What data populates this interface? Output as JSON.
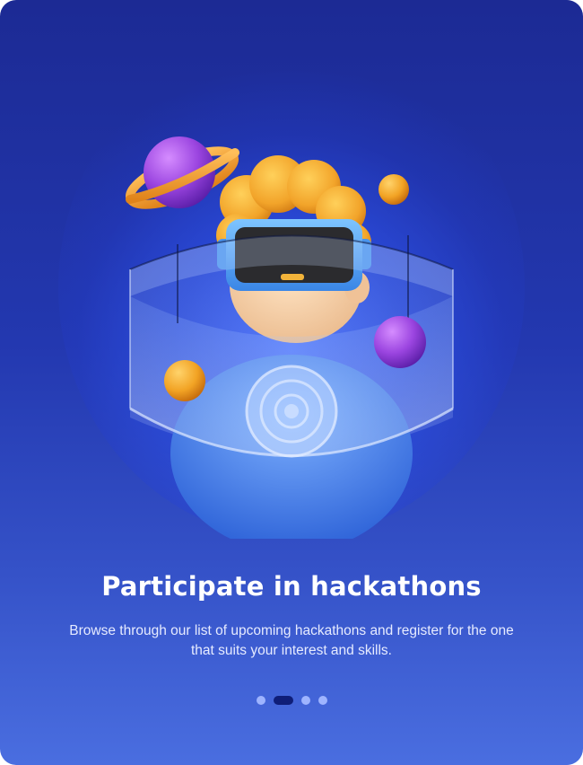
{
  "onboarding": {
    "title": "Participate in hackathons",
    "description": "Browse through our list of upcoming hackathons and register for the one that suits your interest and skills.",
    "illustration_icon": "vr-avatar-illustration",
    "pagination": {
      "total": 4,
      "active_index": 1
    }
  },
  "colors": {
    "background_top": "#1c2a94",
    "background_bottom": "#4a6ee0",
    "active_dot": "#0f1e78",
    "inactive_dot": "#9eb4ff"
  }
}
